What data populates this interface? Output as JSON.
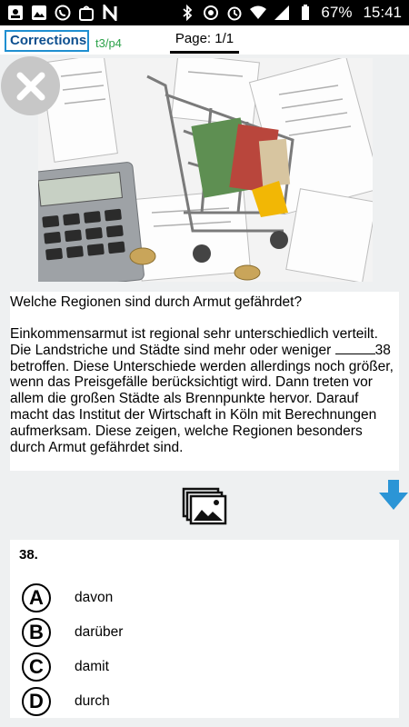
{
  "status_bar": {
    "battery_percent": "67%",
    "time": "15:41"
  },
  "header": {
    "corrections_label": "Corrections",
    "page_ref": "t3/p4",
    "page_label": "Page: 1/1"
  },
  "text": {
    "title": "Welche Regionen sind durch Armut gefährdet?",
    "body_before_blank": "Einkommensarmut ist regional sehr unterschiedlich verteilt. Die Landstriche und Städte sind mehr oder weniger ",
    "blank_number": "38",
    "body_after_blank": " betroffen. Diese Unterschiede werden allerdings noch größer, wenn das Preisgefälle berücksichtigt wird. Dann treten vor allem die großen Städte als Brennpunkte hervor. Darauf macht das Institut der Wirtschaft in Köln mit Berechnungen aufmerksam. Diese zeigen, welche Regionen besonders durch Armut gefährdet sind."
  },
  "question": {
    "number": "38.",
    "options": [
      {
        "letter": "A",
        "text": "davon"
      },
      {
        "letter": "B",
        "text": "darüber"
      },
      {
        "letter": "C",
        "text": "damit"
      },
      {
        "letter": "D",
        "text": "durch"
      }
    ]
  },
  "colors": {
    "accent_blue": "#1f8fd1",
    "page_ref_green": "#2ca24a",
    "arrow_blue": "#2b95d6"
  }
}
